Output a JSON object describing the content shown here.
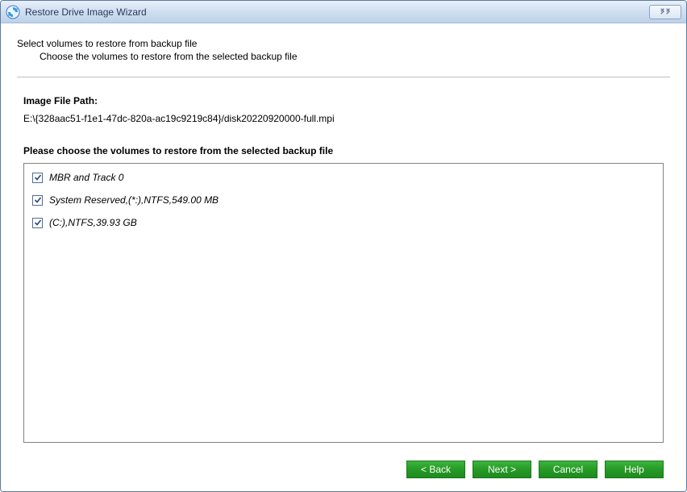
{
  "window": {
    "title": "Restore Drive Image Wizard"
  },
  "header": {
    "line1": "Select volumes to restore from backup file",
    "line2": "Choose the volumes to restore from the selected backup file"
  },
  "path": {
    "label": "Image File Path:",
    "value": "E:\\{328aac51-f1e1-47dc-820a-ac19c9219c84}/disk20220920000-full.mpi"
  },
  "volumes": {
    "prompt": "Please choose the volumes to restore from the selected backup file",
    "items": [
      {
        "label": "MBR and Track 0",
        "checked": true
      },
      {
        "label": "System Reserved,(*:),NTFS,549.00 MB",
        "checked": true
      },
      {
        "label": "(C:),NTFS,39.93 GB",
        "checked": true
      }
    ]
  },
  "buttons": {
    "back": "< Back",
    "next": "Next >",
    "cancel": "Cancel",
    "help": "Help"
  }
}
